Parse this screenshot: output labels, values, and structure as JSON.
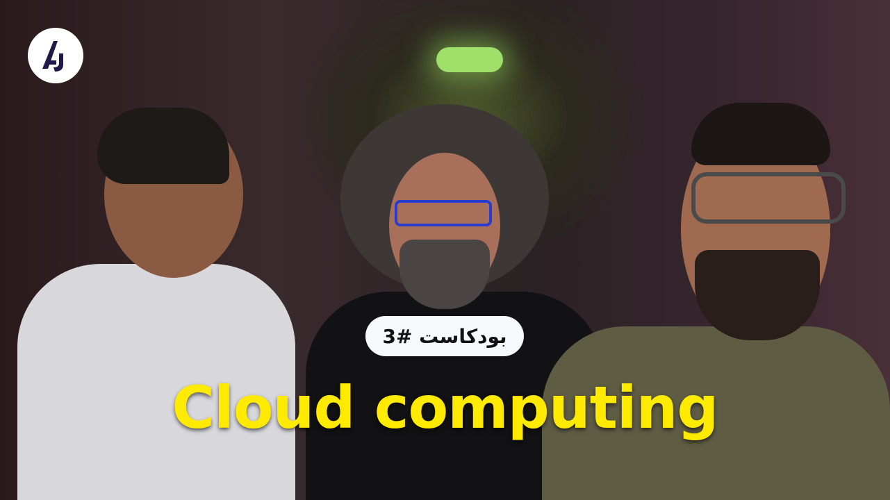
{
  "logo": {
    "text": "AJ",
    "icon": "aj-logo"
  },
  "badge": {
    "label": "بودکاست #3"
  },
  "title": "Cloud computing",
  "colors": {
    "title": "#ffea00",
    "logo_fg": "#1e1a4a",
    "badge_bg": "#f7f8fc"
  }
}
